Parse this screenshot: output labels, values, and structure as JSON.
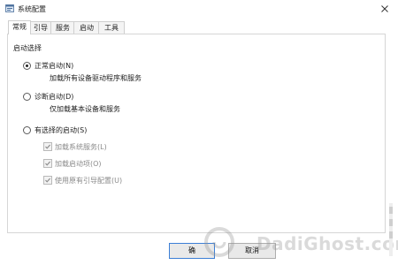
{
  "window": {
    "title": "系统配置",
    "close_glyph": "✕"
  },
  "tabs": [
    {
      "label": "常规",
      "active": true
    },
    {
      "label": "引导",
      "active": false
    },
    {
      "label": "服务",
      "active": false
    },
    {
      "label": "启动",
      "active": false
    },
    {
      "label": "工具",
      "active": false
    }
  ],
  "startup_group": {
    "label": "启动选择",
    "options": [
      {
        "label": "正常启动(N)",
        "description": "加载所有设备驱动程序和服务",
        "selected": true
      },
      {
        "label": "诊断启动(D)",
        "description": "仅加载基本设备和服务",
        "selected": false
      },
      {
        "label": "有选择的启动(S)",
        "description": "",
        "selected": false
      }
    ],
    "selective_items": [
      {
        "label": "加载系统服务(L)",
        "checked": true,
        "enabled": false
      },
      {
        "label": "加载启动项(O)",
        "checked": true,
        "enabled": false
      },
      {
        "label": "使用原有引导配置(U)",
        "checked": true,
        "enabled": false
      }
    ]
  },
  "buttons": {
    "ok": "确",
    "cancel": "取消"
  },
  "watermark": {
    "text": "DadiGhost.com"
  },
  "colors": {
    "accent": "#3c7fd6",
    "disabled_text": "#8a8a8a",
    "border": "#d6d6d6"
  }
}
